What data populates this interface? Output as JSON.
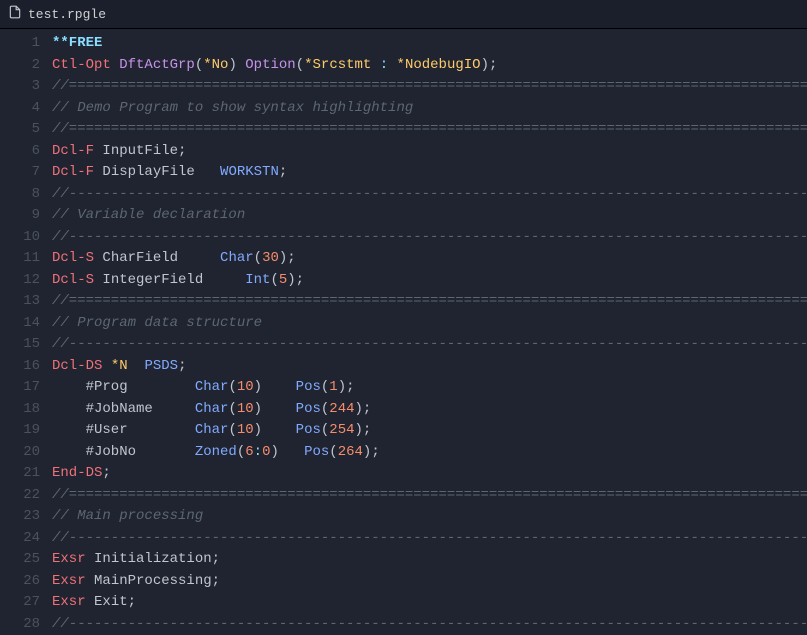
{
  "file": {
    "name": "test.rpgle"
  },
  "gutter": [
    "1",
    "2",
    "3",
    "4",
    "5",
    "6",
    "7",
    "8",
    "9",
    "10",
    "11",
    "12",
    "13",
    "14",
    "15",
    "16",
    "17",
    "18",
    "19",
    "20",
    "21",
    "22",
    "23",
    "24",
    "25",
    "26",
    "27",
    "28"
  ],
  "lines": [
    [
      [
        "free",
        "**FREE"
      ]
    ],
    [
      [
        "kw1",
        "Ctl-Opt"
      ],
      [
        "txt",
        " "
      ],
      [
        "kw2",
        "DftActGrp"
      ],
      [
        "pun",
        "("
      ],
      [
        "fn",
        "*No"
      ],
      [
        "pun",
        ") "
      ],
      [
        "kw2",
        "Option"
      ],
      [
        "pun",
        "("
      ],
      [
        "fn",
        "*Srcstmt"
      ],
      [
        "txt",
        " "
      ],
      [
        "op",
        ":"
      ],
      [
        "txt",
        " "
      ],
      [
        "fn",
        "*NodebugIO"
      ],
      [
        "pun",
        ");"
      ]
    ],
    [
      [
        "cmt",
        "//==========================================================================================*"
      ]
    ],
    [
      [
        "cmt",
        "// Demo Program to show syntax highlighting"
      ]
    ],
    [
      [
        "cmt",
        "//==========================================================================================*"
      ]
    ],
    [
      [
        "kw1",
        "Dcl-F"
      ],
      [
        "txt",
        " InputFile;"
      ]
    ],
    [
      [
        "kw1",
        "Dcl-F"
      ],
      [
        "txt",
        " DisplayFile   "
      ],
      [
        "type",
        "WORKSTN"
      ],
      [
        "pun",
        ";"
      ]
    ],
    [
      [
        "cmt",
        "//------------------------------------------------------------------------------------------*"
      ]
    ],
    [
      [
        "cmt",
        "// Variable declaration"
      ]
    ],
    [
      [
        "cmt",
        "//------------------------------------------------------------------------------------------*"
      ]
    ],
    [
      [
        "kw1",
        "Dcl-S"
      ],
      [
        "txt",
        " CharField     "
      ],
      [
        "type",
        "Char"
      ],
      [
        "pun",
        "("
      ],
      [
        "num",
        "30"
      ],
      [
        "pun",
        ");"
      ]
    ],
    [
      [
        "kw1",
        "Dcl-S"
      ],
      [
        "txt",
        " IntegerField     "
      ],
      [
        "type",
        "Int"
      ],
      [
        "pun",
        "("
      ],
      [
        "num",
        "5"
      ],
      [
        "pun",
        ");"
      ]
    ],
    [
      [
        "cmt",
        "//==========================================================================================*"
      ]
    ],
    [
      [
        "cmt",
        "// Program data structure"
      ]
    ],
    [
      [
        "cmt",
        "//------------------------------------------------------------------------------------------*"
      ]
    ],
    [
      [
        "kw1",
        "Dcl-DS"
      ],
      [
        "txt",
        " "
      ],
      [
        "fn",
        "*N"
      ],
      [
        "txt",
        "  "
      ],
      [
        "type",
        "PSDS"
      ],
      [
        "pun",
        ";"
      ]
    ],
    [
      [
        "txt",
        "    #Prog        "
      ],
      [
        "type",
        "Char"
      ],
      [
        "pun",
        "("
      ],
      [
        "num",
        "10"
      ],
      [
        "pun",
        ")    "
      ],
      [
        "type",
        "Pos"
      ],
      [
        "pun",
        "("
      ],
      [
        "num",
        "1"
      ],
      [
        "pun",
        ");"
      ]
    ],
    [
      [
        "txt",
        "    #JobName     "
      ],
      [
        "type",
        "Char"
      ],
      [
        "pun",
        "("
      ],
      [
        "num",
        "10"
      ],
      [
        "pun",
        ")    "
      ],
      [
        "type",
        "Pos"
      ],
      [
        "pun",
        "("
      ],
      [
        "num",
        "244"
      ],
      [
        "pun",
        ");"
      ]
    ],
    [
      [
        "txt",
        "    #User        "
      ],
      [
        "type",
        "Char"
      ],
      [
        "pun",
        "("
      ],
      [
        "num",
        "10"
      ],
      [
        "pun",
        ")    "
      ],
      [
        "type",
        "Pos"
      ],
      [
        "pun",
        "("
      ],
      [
        "num",
        "254"
      ],
      [
        "pun",
        ");"
      ]
    ],
    [
      [
        "txt",
        "    #JobNo       "
      ],
      [
        "type",
        "Zoned"
      ],
      [
        "pun",
        "("
      ],
      [
        "num",
        "6"
      ],
      [
        "op",
        ":"
      ],
      [
        "num",
        "0"
      ],
      [
        "pun",
        ")   "
      ],
      [
        "type",
        "Pos"
      ],
      [
        "pun",
        "("
      ],
      [
        "num",
        "264"
      ],
      [
        "pun",
        ");"
      ]
    ],
    [
      [
        "kw1",
        "End-DS"
      ],
      [
        "pun",
        ";"
      ]
    ],
    [
      [
        "cmt",
        "//==========================================================================================*"
      ]
    ],
    [
      [
        "cmt",
        "// Main processing"
      ]
    ],
    [
      [
        "cmt",
        "//------------------------------------------------------------------------------------------*"
      ]
    ],
    [
      [
        "kw1",
        "Exsr"
      ],
      [
        "txt",
        " Initialization;"
      ]
    ],
    [
      [
        "kw1",
        "Exsr"
      ],
      [
        "txt",
        " MainProcessing;"
      ]
    ],
    [
      [
        "kw1",
        "Exsr"
      ],
      [
        "txt",
        " Exit;"
      ]
    ],
    [
      [
        "cmt",
        "//------------------------------------------------------------------------------------------*"
      ]
    ]
  ]
}
